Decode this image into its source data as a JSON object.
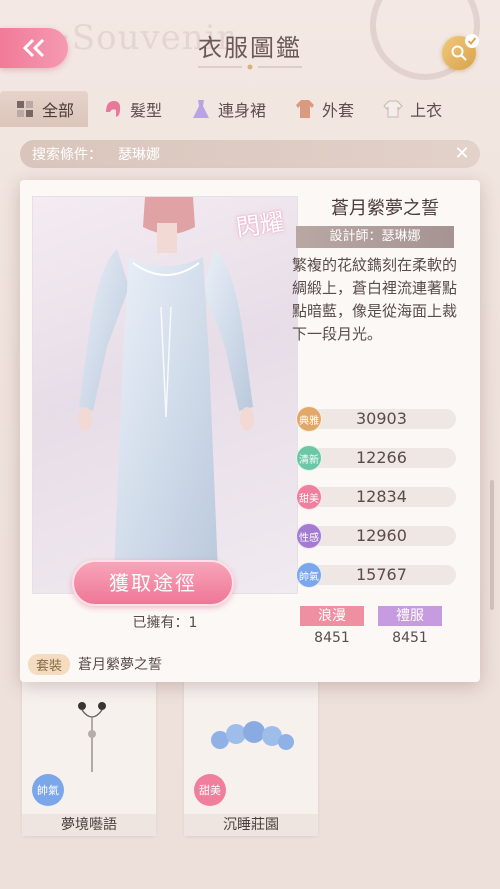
{
  "header": {
    "title": "衣服圖鑑"
  },
  "tabs": [
    {
      "label": "全部",
      "icon": "grid-icon",
      "active": true
    },
    {
      "label": "髮型",
      "icon": "hair-icon"
    },
    {
      "label": "連身裙",
      "icon": "dress-icon"
    },
    {
      "label": "外套",
      "icon": "coat-icon"
    },
    {
      "label": "上衣",
      "icon": "top-icon"
    }
  ],
  "filter": {
    "label": "搜索條件：",
    "value": "瑟琳娜"
  },
  "detail": {
    "name": "蒼月縈夢之誓",
    "designer": "設計師：瑟琳娜",
    "description": "繁複的花紋鐫刻在柔軟的綢緞上，蒼白裡流連著點點暗藍，像是從海面上裁下一段月光。",
    "rarity_badge": "閃耀",
    "get_button": "獲取途徑",
    "owned": "已擁有：1",
    "suit_tag": "套裝",
    "suit_name": "蒼月縈夢之誓",
    "stats": [
      {
        "name": "典雅",
        "value": "30903",
        "color": "#e2a86a"
      },
      {
        "name": "清新",
        "value": "12266",
        "color": "#6cc7a7"
      },
      {
        "name": "甜美",
        "value": "12834",
        "color": "#ef7f9d"
      },
      {
        "name": "性感",
        "value": "12960",
        "color": "#a47bd1"
      },
      {
        "name": "帥氣",
        "value": "15767",
        "color": "#7ca6ea"
      }
    ],
    "tags": [
      {
        "label": "浪漫",
        "value": "8451",
        "color": "#ef8fa2"
      },
      {
        "label": "禮服",
        "value": "8451",
        "color": "#c79be0"
      }
    ]
  },
  "cards": [
    {
      "name": "夢境囈語",
      "attr": "帥氣",
      "attr_color": "#7ca6ea"
    },
    {
      "name": "沉睡莊園",
      "attr": "甜美",
      "attr_color": "#ef7f9d"
    }
  ]
}
